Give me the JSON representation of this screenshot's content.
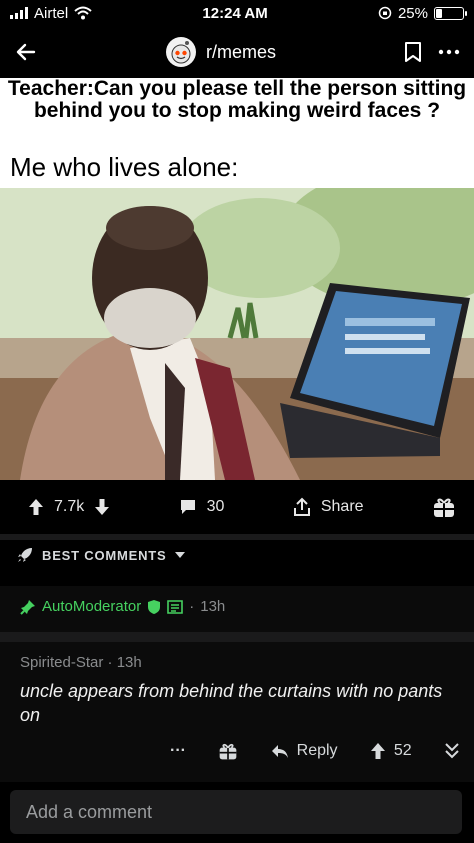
{
  "status_bar": {
    "carrier": "Airtel",
    "time": "12:24 AM",
    "battery": "25%",
    "battery_level": 0.25
  },
  "header": {
    "subreddit": "r/memes"
  },
  "meme": {
    "caption": "Teacher:Can you please tell the person sitting behind you to stop making weird faces ?",
    "subcaption": "Me who lives alone:"
  },
  "post_actions": {
    "upvotes": "7.7k",
    "comments": "30",
    "share_label": "Share"
  },
  "sort": {
    "label": "BEST COMMENTS"
  },
  "automod": {
    "name": "AutoModerator",
    "separator": "·",
    "age": "13h"
  },
  "comment": {
    "author": "Spirited-Star",
    "separator": "·",
    "age": "13h",
    "body": "uncle appears from behind the curtains with no pants on",
    "more": "···",
    "reply_label": "Reply",
    "score": "52"
  },
  "composer": {
    "placeholder": "Add a comment"
  },
  "colors": {
    "accent_green": "#46d160",
    "background": "#000000"
  }
}
